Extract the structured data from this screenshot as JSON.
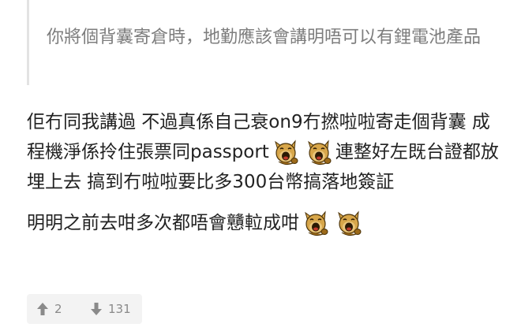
{
  "quote": {
    "text": "你將個背囊寄倉時，地勤應該會講明唔可以有鋰電池產品"
  },
  "reply": {
    "p1_a": "佢冇同我講過 不過真係自己衰on9冇撚啦啦寄走個背囊 成程機淨係拎住張票同passport",
    "p1_b": "連整好左既台證都放埋上去 搞到冇啦啦要比多300台幣搞落地簽証",
    "p2": "明明之前去咁多次都唔會戇𨋢成咁"
  },
  "emoji": {
    "name": "laughing-dog-emoji",
    "colors": {
      "face": "#d7a64a",
      "shade": "#9c6a1a",
      "outline": "#4a3208",
      "mouth": "#2b1a05"
    }
  },
  "votes": {
    "up_count": "2",
    "down_count": "131",
    "up_icon": "arrow-up-icon",
    "down_icon": "arrow-down-icon",
    "icon_color": "#8a8a8a"
  }
}
